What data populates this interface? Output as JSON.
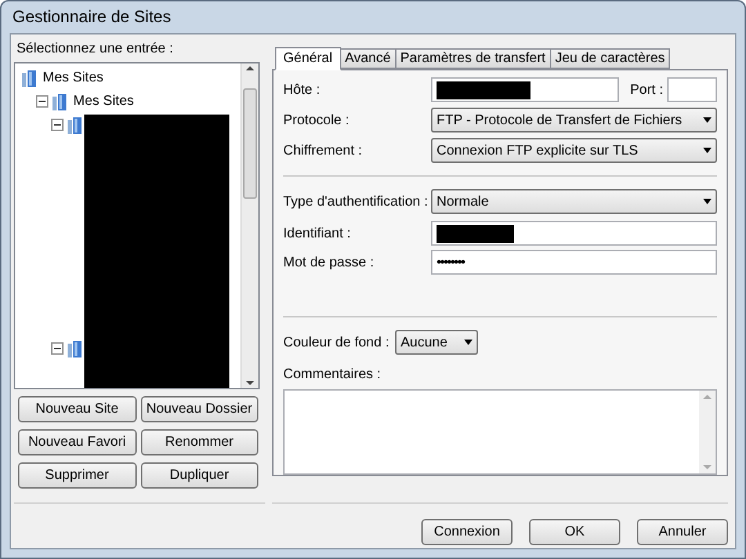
{
  "window": {
    "title": "Gestionnaire de Sites"
  },
  "site_list": {
    "label": "Sélectionnez une entrée :",
    "redacted": true,
    "tree": [
      {
        "label": "Mes Sites",
        "children": [
          {
            "label": "Mes Sites",
            "expanded": true,
            "children": [
              {
                "expanded": true
              },
              {
                "expanded": true
              }
            ]
          }
        ]
      }
    ]
  },
  "site_buttons": [
    "Nouveau Site",
    "Nouveau Dossier",
    "Nouveau Favori",
    "Renommer",
    "Supprimer",
    "Dupliquer"
  ],
  "tabs": [
    {
      "label": "Général",
      "selected": true
    },
    {
      "label": "Avancé",
      "selected": false
    },
    {
      "label": "Paramètres de transfert",
      "selected": false
    },
    {
      "label": "Jeu de caractères",
      "selected": false
    }
  ],
  "general": {
    "host": {
      "label": "Hôte :",
      "redacted": true
    },
    "port": {
      "label": "Port :"
    },
    "protocol": {
      "label": "Protocole :",
      "value": "FTP - Protocole de Transfert de Fichiers"
    },
    "encryption": {
      "label": "Chiffrement :",
      "value": "Connexion FTP explicite sur TLS"
    },
    "auth_type": {
      "label": "Type d'authentification :",
      "value": "Normale"
    },
    "user": {
      "label": "Identifiant :",
      "redacted": true
    },
    "password": {
      "label": "Mot de passe :",
      "value": "••••••••"
    },
    "background_color": {
      "label": "Couleur de fond :",
      "value": "Aucune"
    },
    "comments": {
      "label": "Commentaires :"
    }
  },
  "dialog_buttons": [
    "Connexion",
    "OK",
    "Annuler"
  ]
}
